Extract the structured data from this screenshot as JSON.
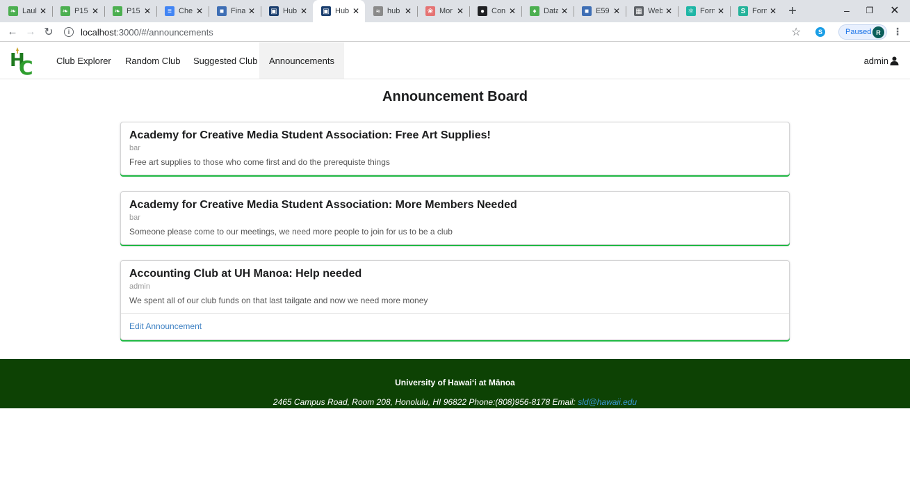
{
  "browser": {
    "tabs": [
      {
        "title": "Laul",
        "favicon": "leaf-icon",
        "color": "#4caf50",
        "active": false
      },
      {
        "title": "P15",
        "favicon": "leaf-icon",
        "color": "#4caf50",
        "active": false
      },
      {
        "title": "P15",
        "favicon": "leaf-icon",
        "color": "#4caf50",
        "active": false
      },
      {
        "title": "Che",
        "favicon": "docs-icon",
        "color": "#4285f4",
        "active": false
      },
      {
        "title": "Fina",
        "favicon": "slides-icon",
        "color": "#3f6fb5",
        "active": false
      },
      {
        "title": "Hub",
        "favicon": "hub-icon",
        "color": "#1a3e6e",
        "active": false
      },
      {
        "title": "Hub",
        "favicon": "hub-icon",
        "color": "#1a3e6e",
        "active": true
      },
      {
        "title": "hub",
        "favicon": "wing-icon",
        "color": "#8a8a8a",
        "active": false
      },
      {
        "title": "Mor",
        "favicon": "feather-icon",
        "color": "#e57373",
        "active": false
      },
      {
        "title": "Con",
        "favicon": "github-icon",
        "color": "#202124",
        "active": false
      },
      {
        "title": "Data",
        "favicon": "mongodb-icon",
        "color": "#4caf50",
        "active": false
      },
      {
        "title": "E59",
        "favicon": "slides-icon",
        "color": "#3f6fb5",
        "active": false
      },
      {
        "title": "Web",
        "favicon": "grid-icon",
        "color": "#5f6368",
        "active": false
      },
      {
        "title": "Forn",
        "favicon": "react-icon",
        "color": "#1fb6a6",
        "active": false
      },
      {
        "title": "Forn",
        "favicon": "s-icon",
        "color": "#26b39b",
        "active": false
      }
    ],
    "url_host": "localhost",
    "url_path": ":3000/#/announcements",
    "profile_status": "Paused",
    "profile_initial": "R",
    "skype_letter": "S"
  },
  "nav": {
    "items": [
      {
        "label": "Club Explorer",
        "active": false
      },
      {
        "label": "Random Club",
        "active": false
      },
      {
        "label": "Suggested Club",
        "active": false
      },
      {
        "label": "Announcements",
        "active": true
      }
    ],
    "user": "admin"
  },
  "page": {
    "title": "Announcement Board"
  },
  "announcements": [
    {
      "title": "Academy for Creative Media Student Association: Free Art Supplies!",
      "author": "bar",
      "body": "Free art supplies to those who come first and do the prerequiste things",
      "edit_label": ""
    },
    {
      "title": "Academy for Creative Media Student Association: More Members Needed",
      "author": "bar",
      "body": "Someone please come to our meetings, we need more people to join for us to be a club",
      "edit_label": ""
    },
    {
      "title": "Accounting Club at UH Manoa: Help needed",
      "author": "admin",
      "body": "We spent all of our club funds on that last tailgate and now we need more money",
      "edit_label": "Edit Announcement"
    }
  ],
  "footer": {
    "university": "University of Hawaiʻi at Mānoa",
    "address": "2465 Campus Road, Room 208, Honolulu, HI 96822 Phone:(808)956-8178",
    "email_label": "Email:",
    "email": "sld@hawaii.edu"
  },
  "colors": {
    "footer_bg": "#0d4204",
    "card_accent": "#21ba45",
    "link": "#4183c4"
  }
}
